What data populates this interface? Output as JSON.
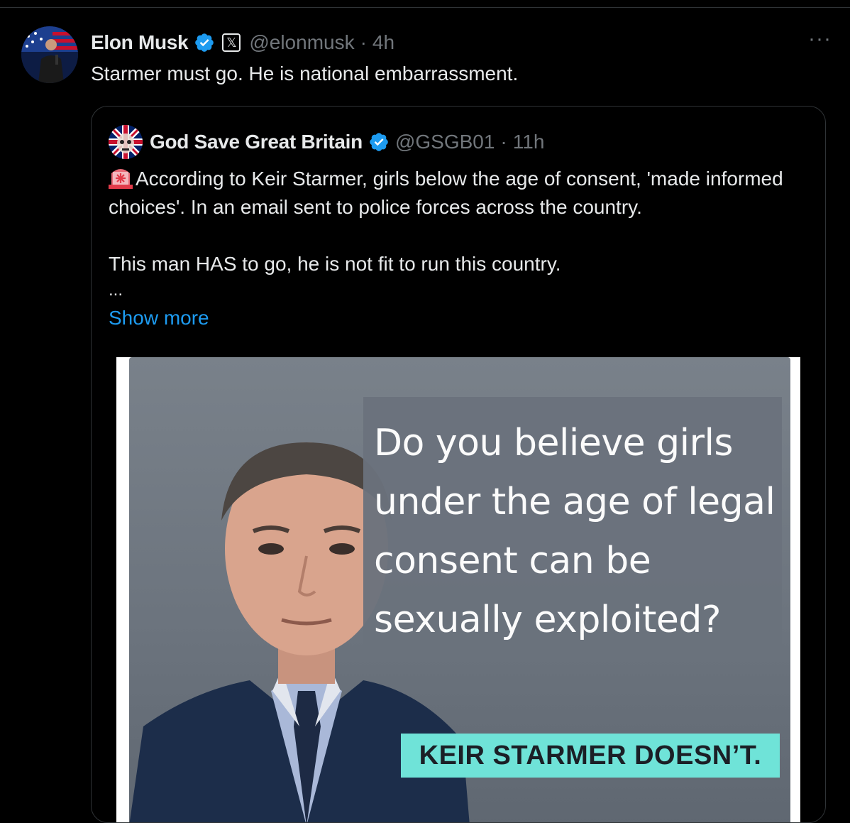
{
  "tweet": {
    "author": {
      "name": "Elon Musk",
      "handle": "@elonmusk",
      "badge_icon": "x-affiliate-badge"
    },
    "time": "4h",
    "separator": "·",
    "text": "Starmer must go. He is national embarrassment.",
    "more_icon": "more-options-icon"
  },
  "quoted": {
    "author": {
      "name": "God Save Great Britain",
      "handle": "@GSGB01"
    },
    "time": "11h",
    "separator": "·",
    "paragraph1": "According to Keir Starmer, girls below the age of consent, 'made informed choices'. In an email sent to police forces across the country.",
    "paragraph2": "This man HAS to go, he is not fit to run this country.",
    "ellipsis": "...",
    "show_more": "Show more",
    "media": {
      "question": "Do you believe girls under the age of legal consent can be sexually exploited?",
      "caption": "KEIR STARMER DOESN’T."
    }
  },
  "colors": {
    "background": "#000000",
    "text": "#e7e9ea",
    "muted": "#71767b",
    "link": "#1d9bf0",
    "verified": "#1d9bf0",
    "caption_bg": "#6fe3d8"
  }
}
